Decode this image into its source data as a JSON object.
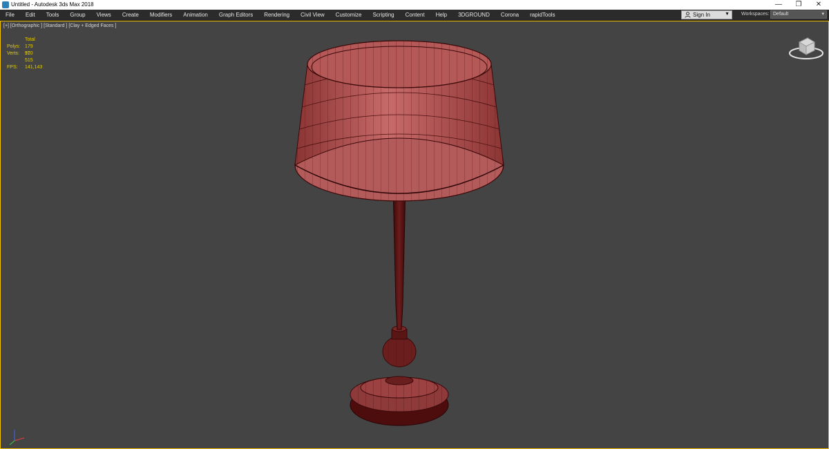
{
  "window": {
    "title": "Untitled - Autodesk 3ds Max 2018",
    "minimize_glyph": "—",
    "restore_glyph": "❐",
    "close_glyph": "✕"
  },
  "menubar": {
    "items": [
      "File",
      "Edit",
      "Tools",
      "Group",
      "Views",
      "Create",
      "Modifiers",
      "Animation",
      "Graph Editors",
      "Rendering",
      "Civil View",
      "Customize",
      "Scripting",
      "Content",
      "Help",
      "3DGROUND",
      "Corona",
      "rapidTools"
    ]
  },
  "signin": {
    "label": "Sign In"
  },
  "workspaces": {
    "label": "Workspaces:",
    "value": "Default"
  },
  "viewport": {
    "label": "[+] [Orthographic ] [Standard ] [Clay + Edged Faces ]",
    "stats": {
      "header": "Total",
      "polys_label": "Polys:",
      "polys_value": "179 370",
      "verts_label": "Verts:",
      "verts_value": "91 515",
      "fps_label": "FPS:",
      "fps_value": "141,143"
    }
  },
  "colors": {
    "viewport_bg": "#444444",
    "active_border": "#f2c200",
    "stats_text": "#e6cc00",
    "model_fill": "#b05050",
    "model_dark": "#5a1414",
    "wire": "#3a0808"
  },
  "icons": {
    "app": "3ds-max-icon",
    "user": "user-icon",
    "viewcube": "viewcube-icon",
    "axis": "axis-tripod-icon"
  }
}
